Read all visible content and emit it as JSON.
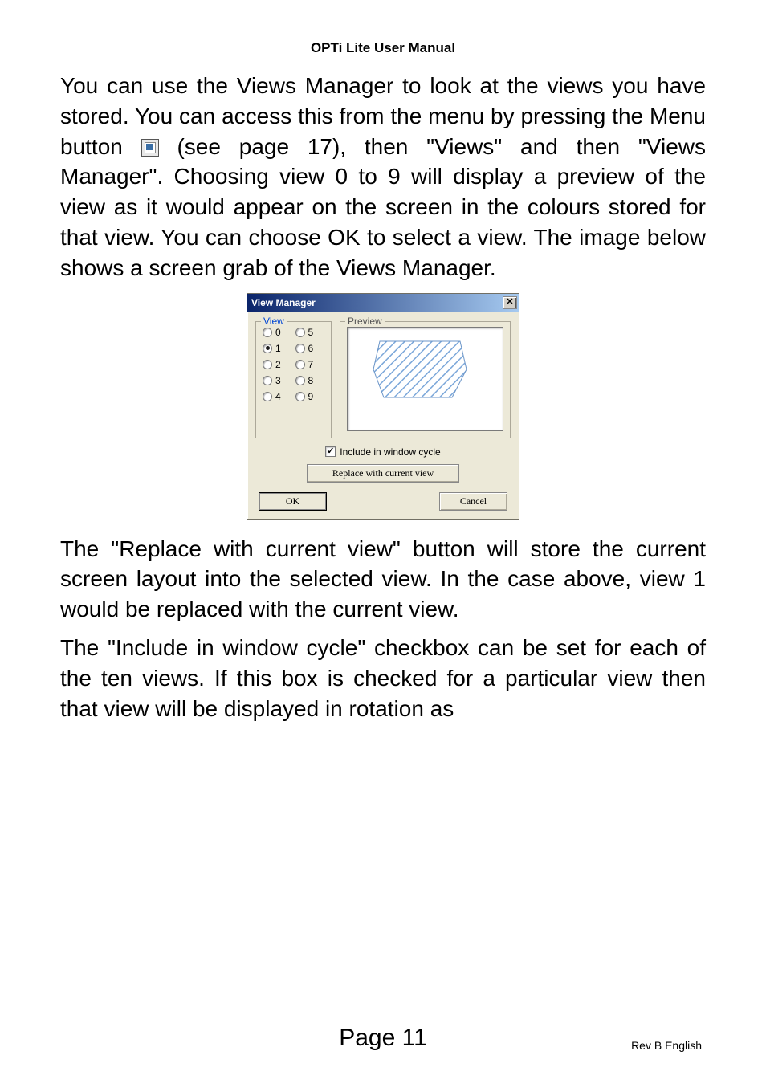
{
  "header": {
    "title": "OPTi Lite User Manual"
  },
  "para1_a": "You can use the Views Manager to look at the views you have stored. You can access this from the menu by pressing the Menu button ",
  "para1_b": " (see page 17), then \"Views\" and then \"Views Manager\".  Choosing view 0 to 9 will display a preview of the view as it would appear on the screen in the colours stored for that view. You can choose OK to select a view.  The image below shows a screen grab of the Views Manager.",
  "dialog": {
    "title": "View Manager",
    "view_legend": "View",
    "preview_legend": "Preview",
    "radios_left": [
      "0",
      "1",
      "2",
      "3",
      "4"
    ],
    "radios_right": [
      "5",
      "6",
      "7",
      "8",
      "9"
    ],
    "selected_index": 1,
    "include_label": "Include in window cycle",
    "include_checked": true,
    "replace_label": "Replace with current view",
    "ok_label": "OK",
    "cancel_label": "Cancel"
  },
  "para2": "The \"Replace with current view\" button will store the current screen layout into the selected view. In the case above, view 1 would be replaced with the current view.",
  "para3": "The \"Include in window cycle\" checkbox can be set for each of the ten views. If this box is checked for a particular view then that view will be displayed in rotation as",
  "footer": {
    "page": "Page 11",
    "rev": "Rev B English"
  }
}
